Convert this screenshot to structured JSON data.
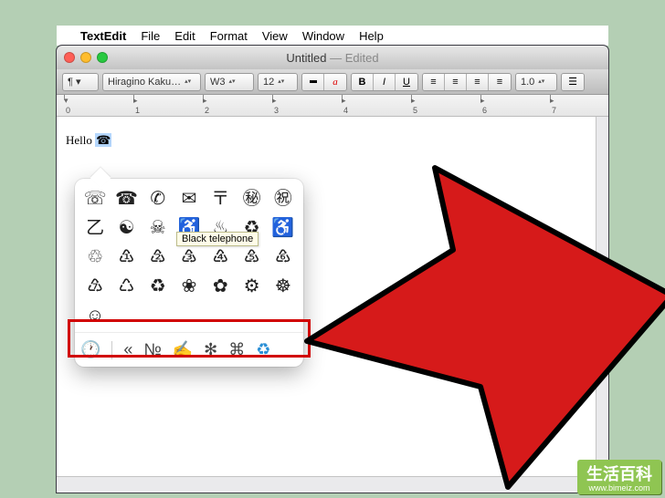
{
  "menubar": {
    "apple": "",
    "app_name": "TextEdit",
    "items": [
      "File",
      "Edit",
      "Format",
      "View",
      "Window",
      "Help"
    ]
  },
  "window": {
    "title": "Untitled",
    "title_suffix": " — Edited"
  },
  "toolbar": {
    "style_combo": "¶ ▾",
    "font_combo": "Hiragino Kaku…",
    "weight_combo": "W3",
    "size_combo": "12",
    "bold": "B",
    "italic": "I",
    "underline": "U",
    "spacing_combo": "1.0"
  },
  "ruler": {
    "numbers": [
      "0",
      "1",
      "2",
      "3",
      "4",
      "5",
      "6",
      "7"
    ]
  },
  "document": {
    "text": "Hello ",
    "selected_char": "☎"
  },
  "char_popover": {
    "grid": [
      "☏",
      "☎",
      "✆",
      "✉",
      "〒",
      "㊙",
      "㊗",
      "乙",
      "☯",
      "☠",
      "♿",
      "♨",
      "♻",
      "♿",
      "♲",
      "♳",
      "♴",
      "♵",
      "♶",
      "♷",
      "♸",
      "♹",
      "♺",
      "♻",
      "❀",
      "✿",
      "⚙",
      "☸",
      "☺"
    ],
    "tooltip": "Black telephone",
    "bottombar": [
      "🕐",
      "|",
      "«",
      "№",
      "✍",
      "✻",
      "⌘",
      "♻"
    ]
  },
  "watermark": {
    "main": "生活百科",
    "sub": "www.bimeiz.com"
  }
}
